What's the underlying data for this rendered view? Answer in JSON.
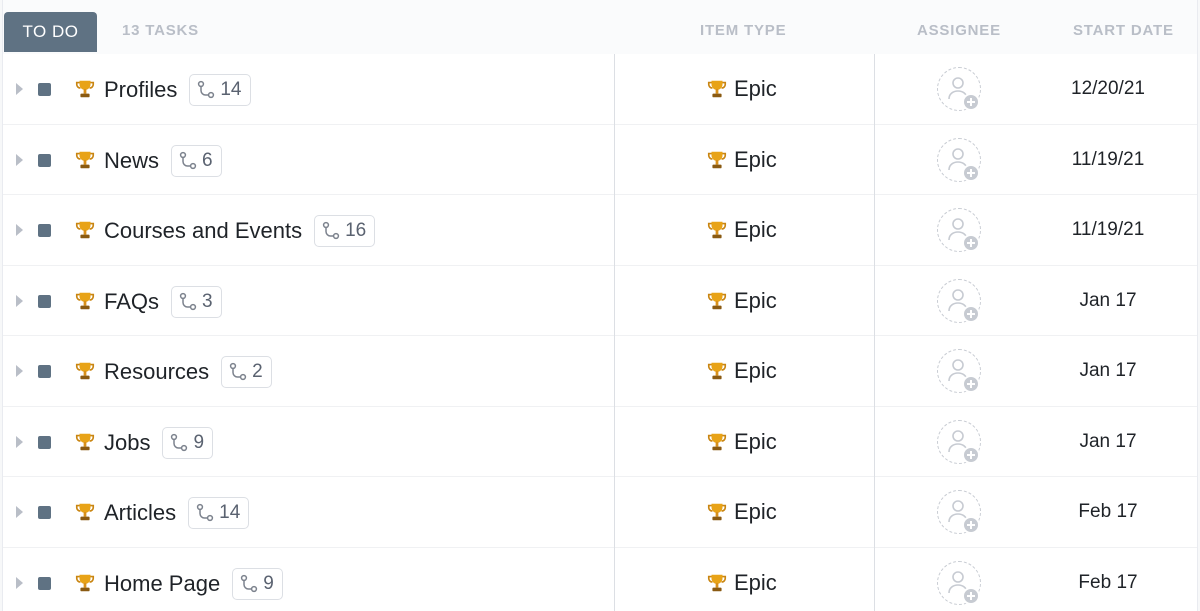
{
  "header": {
    "status_label": "TO DO",
    "task_count": "13 TASKS",
    "columns": {
      "item_type": "ITEM TYPE",
      "assignee": "ASSIGNEE",
      "start_date": "START DATE"
    }
  },
  "colors": {
    "status_accent": "#5f7283",
    "trophy": "#e8a317"
  },
  "rows": [
    {
      "name": "Profiles",
      "subtasks": "14",
      "item_type": "Epic",
      "start_date": "12/20/21"
    },
    {
      "name": "News",
      "subtasks": "6",
      "item_type": "Epic",
      "start_date": "11/19/21"
    },
    {
      "name": "Courses and Events",
      "subtasks": "16",
      "item_type": "Epic",
      "start_date": "11/19/21"
    },
    {
      "name": "FAQs",
      "subtasks": "3",
      "item_type": "Epic",
      "start_date": "Jan 17"
    },
    {
      "name": "Resources",
      "subtasks": "2",
      "item_type": "Epic",
      "start_date": "Jan 17"
    },
    {
      "name": "Jobs",
      "subtasks": "9",
      "item_type": "Epic",
      "start_date": "Jan 17"
    },
    {
      "name": "Articles",
      "subtasks": "14",
      "item_type": "Epic",
      "start_date": "Feb 17"
    },
    {
      "name": "Home Page",
      "subtasks": "9",
      "item_type": "Epic",
      "start_date": "Feb 17"
    }
  ]
}
